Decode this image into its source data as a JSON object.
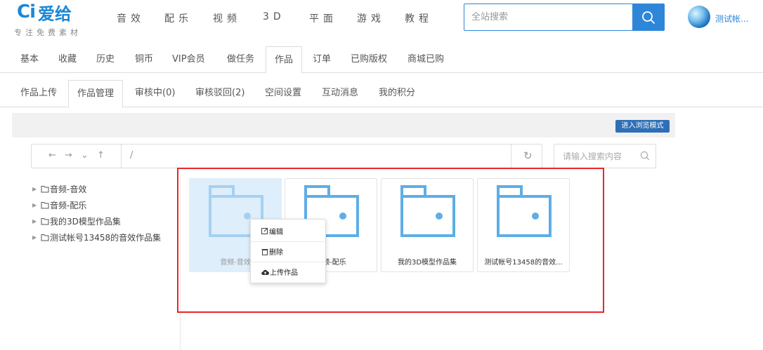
{
  "header": {
    "logo_mark": "Ci",
    "logo_name": "爱给",
    "tagline": "专注免费素材",
    "nav": [
      "音效",
      "配乐",
      "视频",
      "3D",
      "平面",
      "游戏",
      "教程"
    ],
    "search_placeholder": "全站搜索",
    "user_name": "测试帐..."
  },
  "tabs_primary": {
    "items": [
      "基本",
      "收藏",
      "历史",
      "铜币",
      "VIP会员",
      "做任务",
      "作品",
      "订单",
      "已购版权",
      "商城已购"
    ],
    "active": "作品"
  },
  "tabs_secondary": {
    "items": [
      "作品上传",
      "作品管理",
      "审核中(0)",
      "审核驳回(2)",
      "空间设置",
      "互动消息",
      "我的积分"
    ],
    "active": "作品管理"
  },
  "toolbar": {
    "browse_mode_label": "进入浏览模式"
  },
  "pathbar": {
    "path": "/",
    "search_placeholder": "请输入搜索内容"
  },
  "tree": {
    "items": [
      "音频-音效",
      "音频-配乐",
      "我的3D模型作品集",
      "测试帐号13458的音效作品集"
    ]
  },
  "cards": {
    "items": [
      "音频-音效",
      "音频-配乐",
      "我的3D模型作品集",
      "测试帐号13458的音效..."
    ]
  },
  "context_menu": {
    "items": [
      "编辑",
      "删除",
      "上传作品"
    ]
  },
  "colors": {
    "brand_blue": "#2e86d8",
    "folder_blue": "#5eaee6",
    "highlight_red": "#e8262a"
  }
}
